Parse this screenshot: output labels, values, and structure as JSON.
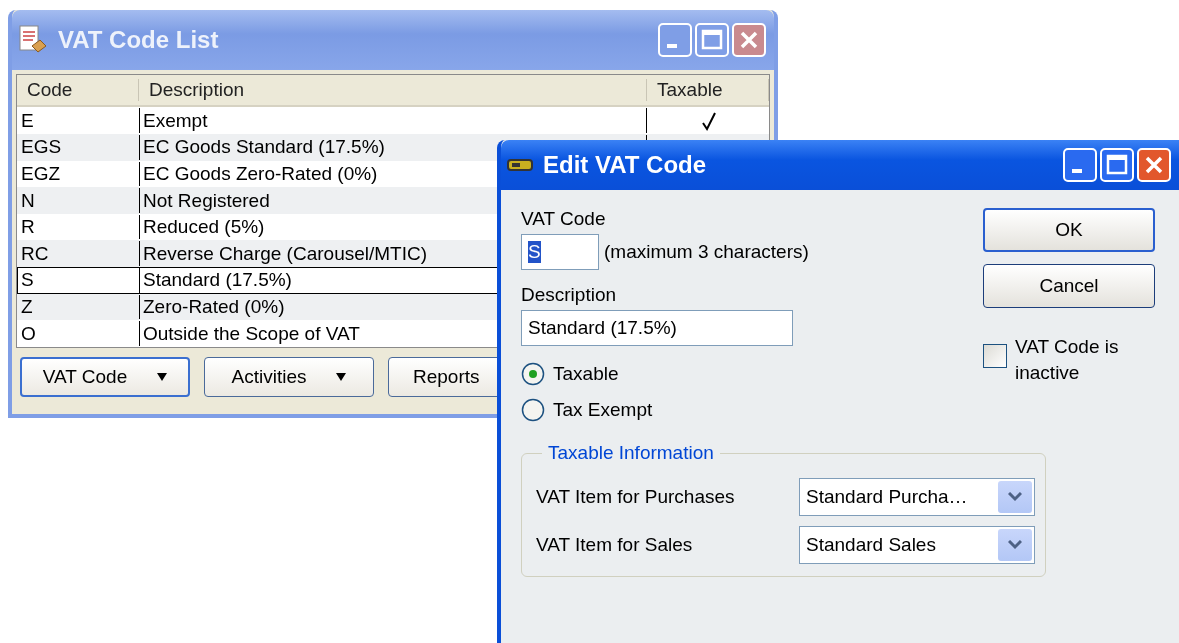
{
  "list_window": {
    "title": "VAT Code List",
    "columns": [
      "Code",
      "Description",
      "Taxable"
    ],
    "rows": [
      {
        "code": "E",
        "description": "Exempt",
        "taxable": true,
        "selected": false
      },
      {
        "code": "EGS",
        "description": "EC Goods Standard (17.5%)",
        "selected": false
      },
      {
        "code": "EGZ",
        "description": "EC Goods Zero-Rated (0%)",
        "selected": false
      },
      {
        "code": "N",
        "description": "Not Registered",
        "selected": false
      },
      {
        "code": "R",
        "description": "Reduced (5%)",
        "selected": false
      },
      {
        "code": "RC",
        "description": "Reverse Charge (Carousel/MTIC)",
        "selected": false
      },
      {
        "code": "S",
        "description": "Standard (17.5%)",
        "selected": true
      },
      {
        "code": "Z",
        "description": "Zero-Rated (0%)",
        "selected": false
      },
      {
        "code": "O",
        "description": "Outside the Scope of VAT",
        "selected": false
      }
    ],
    "buttons": [
      {
        "label": "VAT Code",
        "dropdown": true
      },
      {
        "label": "Activities",
        "dropdown": true
      },
      {
        "label": "Reports",
        "dropdown": false
      }
    ]
  },
  "edit_dialog": {
    "title": "Edit VAT Code",
    "vat_code_label": "VAT Code",
    "vat_code_value": "S",
    "vat_code_hint": "(maximum 3 characters)",
    "description_label": "Description",
    "description_value": "Standard (17.5%)",
    "radios": [
      {
        "label": "Taxable",
        "selected": true
      },
      {
        "label": "Tax Exempt",
        "selected": false
      }
    ],
    "group": {
      "title": "Taxable Information",
      "fields": [
        {
          "label": "VAT Item for Purchases",
          "value": "Standard Purcha…"
        },
        {
          "label": "VAT Item for Sales",
          "value": "Standard Sales"
        }
      ]
    },
    "buttons": [
      "OK",
      "Cancel"
    ],
    "inactive": {
      "label": "VAT Code is inactive",
      "checked": false
    }
  }
}
